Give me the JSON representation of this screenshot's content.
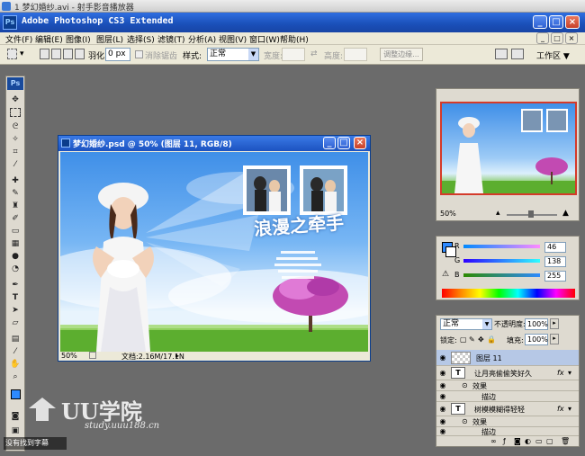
{
  "player": {
    "title": "1 梦幻婚纱.avi - 射手影音播放器"
  },
  "app": {
    "title": "Adobe Photoshop CS3 Extended",
    "logo": "Ps"
  },
  "menu": [
    "文件(F)",
    "编辑(E)",
    "图像(I)",
    "图层(L)",
    "选择(S)",
    "滤镜(T)",
    "分析(A)",
    "视图(V)",
    "窗口(W)",
    "帮助(H)"
  ],
  "options": {
    "feather_label": "羽化:",
    "feather_value": "0 px",
    "antialias_label": "消除锯齿",
    "style_label": "样式:",
    "style_value": "正常",
    "width_label": "宽度:",
    "height_label": "高度:",
    "refine_edge": "调整边缘...",
    "workspace": "工作区 ▼"
  },
  "toolbox": {
    "header": "Ps"
  },
  "document": {
    "title": "梦幻婚纱.psd @ 50% (图层 11, RGB/8)",
    "zoom": "50%",
    "status": "文档:2.16M/17.1N",
    "headline": "浪漫之牵手"
  },
  "navigator": {
    "zoom": "50%"
  },
  "color": {
    "channels": [
      {
        "label": "R",
        "value": "46"
      },
      {
        "label": "G",
        "value": "138"
      },
      {
        "label": "B",
        "value": "255"
      }
    ],
    "foreground": "#2e8aff"
  },
  "layers": {
    "blend_mode": "正常",
    "opacity_label": "不透明度:",
    "opacity_value": "100%",
    "lock_label": "锁定:",
    "fill_label": "填充:",
    "fill_value": "100%",
    "items": [
      {
        "name": "图层 11",
        "type": "image",
        "selected": true
      },
      {
        "name": "让月亮偷偷笑好久",
        "type": "text",
        "fx": "fx"
      },
      {
        "name": "效果",
        "type": "effect-group"
      },
      {
        "name": "描边",
        "type": "effect"
      },
      {
        "name": "树模模糊得轻轻",
        "type": "text",
        "fx": "fx"
      },
      {
        "name": "效果",
        "type": "effect-group"
      },
      {
        "name": "描边",
        "type": "effect"
      }
    ]
  },
  "watermark": {
    "brand": "UU学院",
    "url": "study.uuu188.cn"
  },
  "subtitle_status": "没有找到字幕"
}
